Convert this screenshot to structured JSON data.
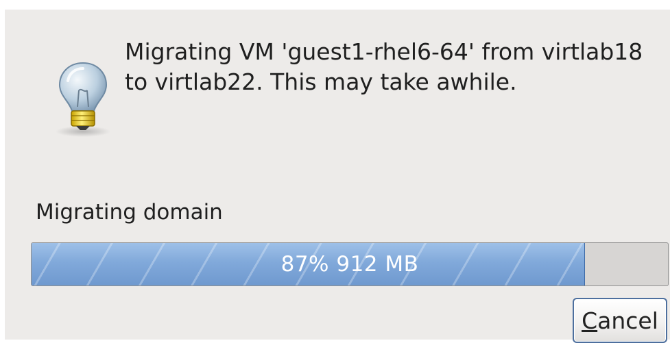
{
  "dialog": {
    "message": "Migrating VM 'guest1-rhel6-64' from virtlab18\nto virtlab22. This may take awhile.",
    "icon": "lightbulb-icon"
  },
  "progress": {
    "label": "Migrating domain",
    "percent": 87,
    "text": "87% 912 MB"
  },
  "buttons": {
    "cancel_mnemonic": "C",
    "cancel_rest": "ancel"
  },
  "colors": {
    "dialog_background": "#edebe9",
    "progress_fill": "#7ea7d8",
    "progress_trough": "#d7d5d3"
  }
}
